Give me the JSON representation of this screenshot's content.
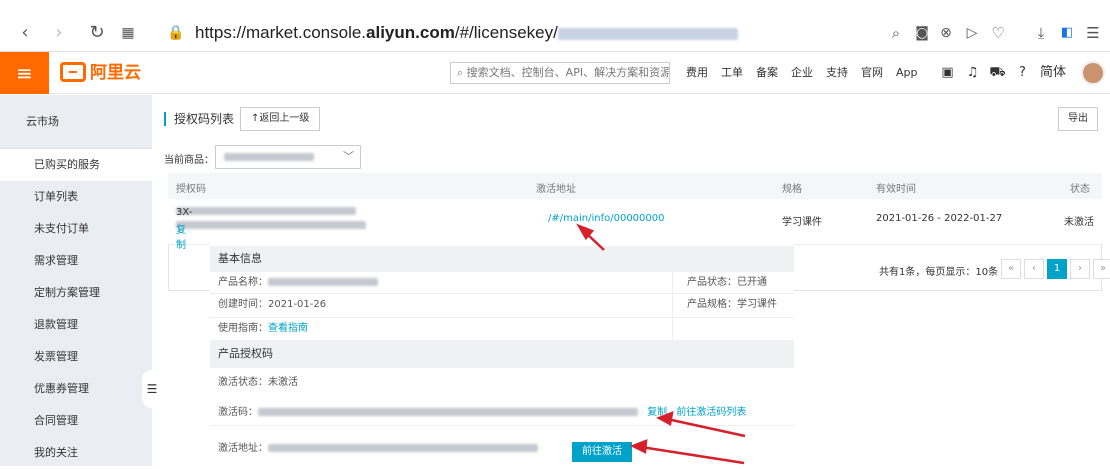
{
  "browser": {
    "url_prefix": "https://market.console.",
    "url_domain": "aliyun.com",
    "url_path": "/#/licensekey/"
  },
  "topnav": {
    "logo_text": "阿里云",
    "search_placeholder": "搜索文档、控制台、API、解决方案和资源",
    "links": [
      "费用",
      "工单",
      "备案",
      "企业",
      "支持",
      "官网",
      "App"
    ],
    "lang": "简体"
  },
  "sidebar": {
    "title": "云市场",
    "items": [
      {
        "label": "已购买的服务",
        "active": true
      },
      {
        "label": "订单列表"
      },
      {
        "label": "未支付订单"
      },
      {
        "label": "需求管理"
      },
      {
        "label": "定制方案管理"
      },
      {
        "label": "退款管理"
      },
      {
        "label": "发票管理"
      },
      {
        "label": "优惠券管理"
      },
      {
        "label": "合同管理"
      },
      {
        "label": "我的关注"
      }
    ]
  },
  "main": {
    "title": "授权码列表",
    "back_button": "返回上一级",
    "export_button": "导出",
    "product_label": "当前商品：",
    "table": {
      "headers": [
        "授权码",
        "激活地址",
        "规格",
        "有效时间",
        "状态"
      ],
      "row": {
        "code_suffix": "3X-",
        "copy": "复制",
        "activation_link": "/#/main/info/00000000",
        "spec": "学习课件",
        "valid": "2021-01-26 - 2022-01-27",
        "status": "未激活"
      }
    },
    "pagination": {
      "summary": "共有1条，每页显示：10条",
      "current": "1",
      "first": "«",
      "prev": "‹",
      "next": "›",
      "last": "»"
    }
  },
  "detail": {
    "basic_title": "基本信息",
    "product_name_label": "产品名称：",
    "product_status": "产品状态：已开通",
    "create_time": "创建时间：2021-01-26",
    "product_spec": "产品规格：学习课件",
    "guide_label": "使用指南：",
    "guide_link": "查看指南",
    "license_title": "产品授权码",
    "activation_status": "激活状态：未激活",
    "activation_code_label": "激活码：",
    "copy": "复制",
    "goto_list": "前往激活码列表",
    "activation_addr_label": "激活地址：",
    "activate_button": "前往激活"
  },
  "colors": {
    "accent": "#00a2ca",
    "brand": "#ff6a00",
    "arrow": "#d6202a"
  }
}
